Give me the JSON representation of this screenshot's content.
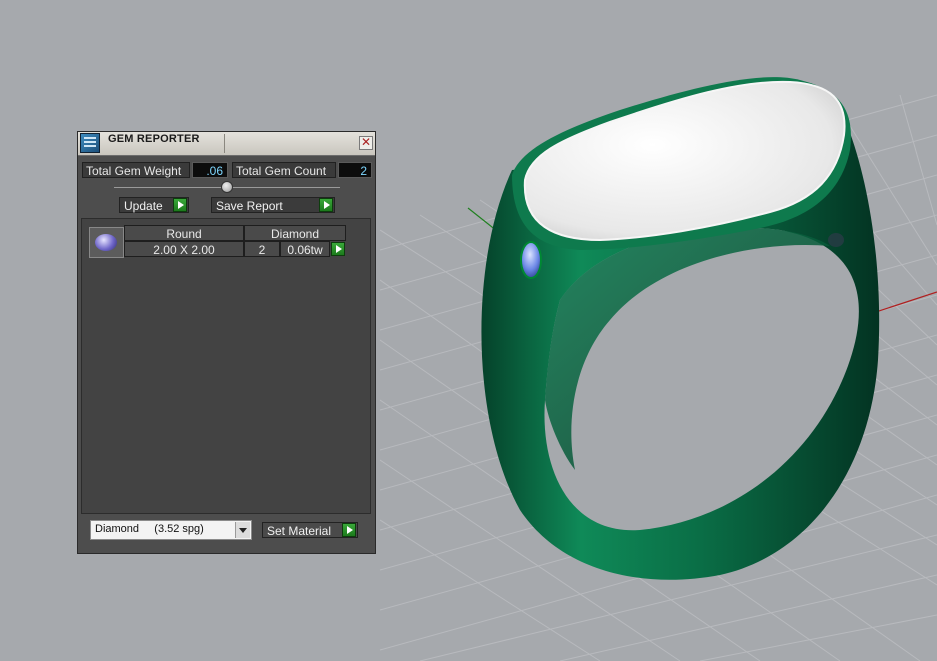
{
  "panel": {
    "title": "GEM REPORTER",
    "close_glyph": "✕",
    "total_gem_weight_label": "Total Gem Weight",
    "total_gem_weight_value": ".06",
    "total_gem_count_label": "Total Gem Count",
    "total_gem_count_value": "2",
    "update_label": "Update",
    "save_report_label": "Save Report",
    "gems": [
      {
        "shape": "Round",
        "size": "2.00 X 2.00",
        "material": "Diamond",
        "count": "2",
        "weight": "0.06tw",
        "thumbnail_icon": "round-gem-icon"
      }
    ],
    "material_selected": "Diamond     (3.52 spg)",
    "set_material_label": "Set Material"
  },
  "viewport": {
    "background_color": "#a6a9ad",
    "grid_color": "#b8babe",
    "ring_color": "#0b6e46",
    "ring_top_color": "#f0f0f0",
    "axis_x_color": "#b02020",
    "axis_y_color": "#208020",
    "gem_color": "#6b87e6"
  },
  "colors": {
    "panel_bg": "#4d4d4d",
    "value_text": "#7ed7ff",
    "play_button": "#2a9a2a"
  }
}
